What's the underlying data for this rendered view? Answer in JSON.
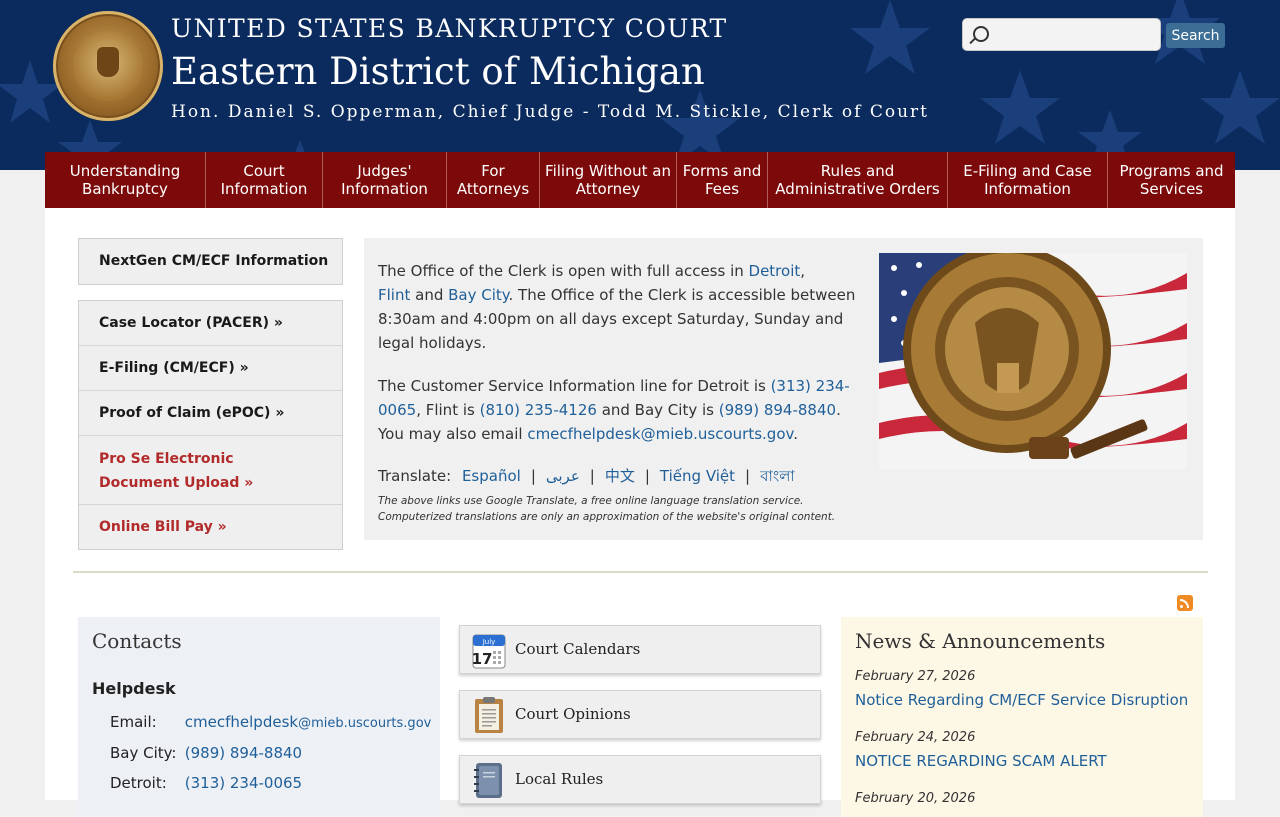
{
  "header": {
    "court": "UNITED STATES BANKRUPTCY COURT",
    "district": "Eastern District of Michigan",
    "judges": "Hon. Daniel S. Opperman, Chief Judge - Todd M. Stickle, Clerk of Court",
    "seal_icon": "court-seal",
    "search_placeholder": "",
    "search_button": "Search"
  },
  "nav": {
    "items": [
      {
        "label": "Understanding Bankruptcy"
      },
      {
        "label": "Court Information"
      },
      {
        "label": "Judges' Information"
      },
      {
        "label": "For Attorneys"
      },
      {
        "label": "Filing Without an Attorney"
      },
      {
        "label": "Forms and Fees"
      },
      {
        "label": "Rules and Administrative Orders"
      },
      {
        "label": "E-Filing and Case Information"
      },
      {
        "label": "Programs and Services"
      }
    ]
  },
  "sidebar": {
    "top_link": "NextGen CM/ECF Information »",
    "links": [
      {
        "label": "Case Locator (PACER) »"
      },
      {
        "label": "E-Filing (CM/ECF) »"
      },
      {
        "label": "Proof of Claim (ePOC) »"
      },
      {
        "label": "Pro Se Electronic Document Upload »"
      },
      {
        "label": "Online Bill Pay »"
      }
    ]
  },
  "info": {
    "p1_pre": "The Office of the Clerk is open with full access in ",
    "detroit": "Detroit",
    "comma": ",",
    "flint": "Flint",
    "and": " and ",
    "bay_city": "Bay City",
    "p1_post": ". The Office of the Clerk is accessible between 8:30am and 4:00pm on all days except Saturday, Sunday and legal holidays.",
    "p2_a": "The Customer Service Information line for Detroit is ",
    "phone_detroit": "(313) 234-0065",
    "p2_b": ", Flint is ",
    "phone_flint": "(810) 235-4126",
    "p2_c": " and Bay City is ",
    "phone_bay": "(989) 894-8840",
    "p2_d": ". You may also email ",
    "email": "cmecfhelpdesk@mieb.uscourts.gov",
    "p2_e": ".",
    "translate_label": "Translate:",
    "languages": [
      "Español",
      "عربى",
      "中文",
      "Tiếng Việt",
      "বাংলা"
    ],
    "separator": "|",
    "disclaimer": "The above links use Google Translate, a free online language translation service. Computerized translations are only an approximation of the website's original content."
  },
  "contacts": {
    "title": "Contacts",
    "section": "Helpdesk",
    "rows": [
      {
        "label": "Email:",
        "value": "cmecfhelpdesk",
        "value_small": "@mieb.uscourts.gov"
      },
      {
        "label": "Bay City:",
        "value": "(989) 894-8840"
      },
      {
        "label": "Detroit:",
        "value": "(313) 234-0065"
      }
    ]
  },
  "quick_links": [
    {
      "label": "Court Calendars",
      "icon": "calendar-icon",
      "cal_month": "July",
      "cal_day": "17"
    },
    {
      "label": "Court Opinions",
      "icon": "clipboard-icon"
    },
    {
      "label": "Local Rules",
      "icon": "notebook-icon"
    }
  ],
  "news": {
    "title": "News & Announcements",
    "items": [
      {
        "date": "February 27, 2026",
        "title": "Notice Regarding CM/ECF Service Disruption"
      },
      {
        "date": "February 24, 2026",
        "title": "NOTICE REGARDING SCAM ALERT"
      },
      {
        "date": "February 20, 2026"
      }
    ]
  },
  "colors": {
    "header_bg": "#0b2b5e",
    "nav_bg": "#7d0a0a",
    "link": "#1f5f99",
    "sidebar_red_link": "#b22a2a",
    "search_button": "#3b6d95"
  }
}
